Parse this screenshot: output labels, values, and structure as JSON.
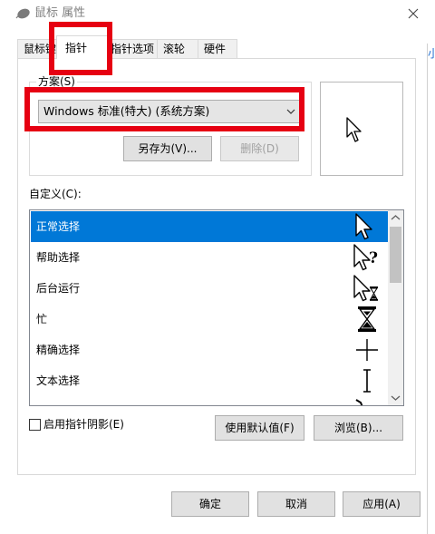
{
  "window": {
    "title": "鼠标 属性"
  },
  "tabs": [
    {
      "label": "鼠标键",
      "active": false
    },
    {
      "label": "指针",
      "active": true
    },
    {
      "label": "指针选项",
      "active": false
    },
    {
      "label": "滚轮",
      "active": false
    },
    {
      "label": "硬件",
      "active": false
    }
  ],
  "scheme": {
    "label": "方案(S)",
    "selected": "Windows 标准(特大) (系统方案)",
    "save_as_label": "另存为(V)...",
    "delete_label": "删除(D)"
  },
  "customize": {
    "label": "自定义(C):",
    "items": [
      {
        "label": "正常选择",
        "icon": "arrow-cursor-icon",
        "selected": true
      },
      {
        "label": "帮助选择",
        "icon": "help-cursor-icon",
        "selected": false
      },
      {
        "label": "后台运行",
        "icon": "working-cursor-icon",
        "selected": false
      },
      {
        "label": "忙",
        "icon": "busy-cursor-icon",
        "selected": false
      },
      {
        "label": "精确选择",
        "icon": "crosshair-cursor-icon",
        "selected": false
      },
      {
        "label": "文本选择",
        "icon": "text-cursor-icon",
        "selected": false
      }
    ]
  },
  "options": {
    "shadow_label": "启用指针阴影(E)",
    "shadow_checked": false,
    "use_default_label": "使用默认值(F)",
    "browse_label": "浏览(B)..."
  },
  "footer": {
    "ok_label": "确定",
    "cancel_label": "取消",
    "apply_label": "应用(A)"
  },
  "background": {
    "edge_text": "小"
  },
  "colors": {
    "selection": "#0078d7",
    "highlight_annotation": "#e60012",
    "button_face": "#e1e1e1"
  }
}
